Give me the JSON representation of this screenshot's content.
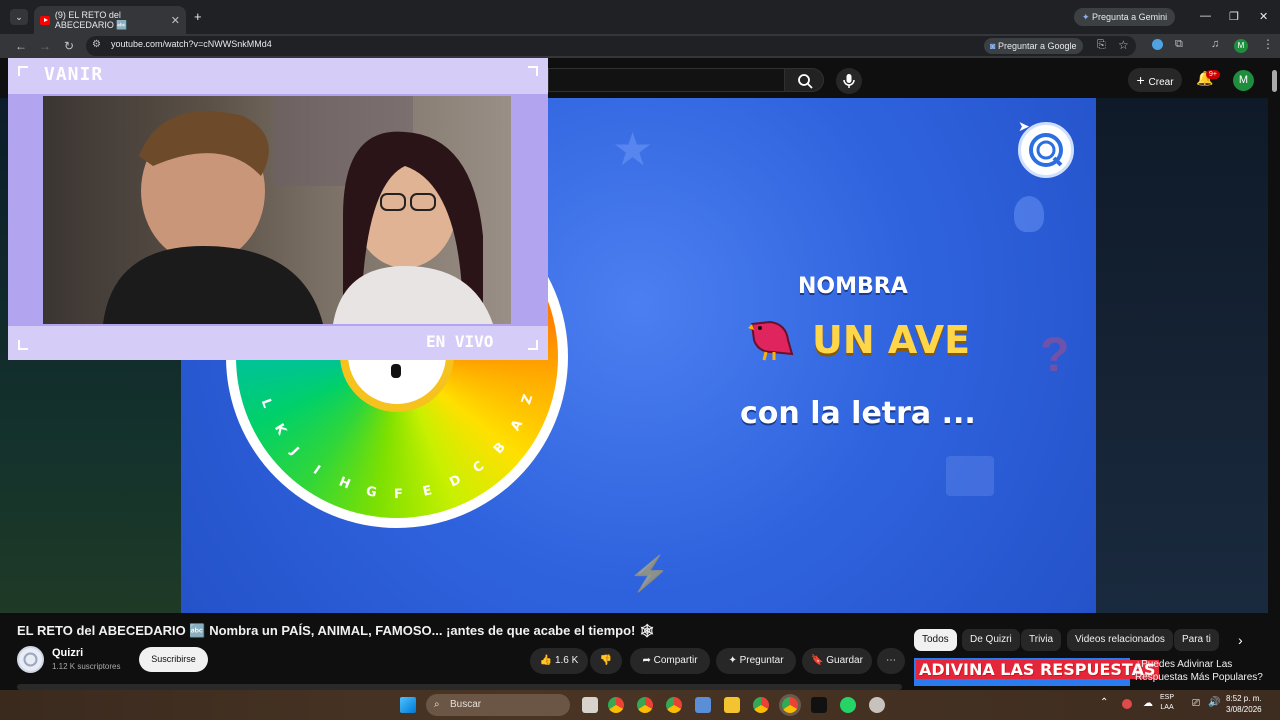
{
  "browser": {
    "tab_title": "(9) EL RETO del ABECEDARIO 🔤",
    "url": "youtube.com/watch?v=cNWWSnkMMd4",
    "ask_google": "Preguntar a Google",
    "ask_gemini": "Pregunta a Gemini",
    "profile_initial": "M"
  },
  "youtube_header": {
    "create_label": "Crear",
    "notification_badge": "9+",
    "avatar_initial": "M"
  },
  "stream_overlay": {
    "name": "VANIR",
    "live_label": "EN VIVO"
  },
  "video": {
    "prompt_top": "NOMBRA",
    "prompt_main": "UN AVE",
    "prompt_bottom": "con la letra ...",
    "wheel_letters": [
      "Z",
      "A",
      "B",
      "C",
      "D",
      "E",
      "F",
      "G",
      "H",
      "I",
      "J",
      "K",
      "L"
    ]
  },
  "video_info": {
    "title": "EL RETO del ABECEDARIO 🔤 Nombra un PAÍS, ANIMAL, FAMOSO... ¡antes de que acabe el tiempo! 🕸",
    "channel_name": "Quizri",
    "subscribers": "1.12 K suscriptores",
    "subscribe_label": "Suscribirse",
    "likes": "1.6 K",
    "share_label": "Compartir",
    "ask_label": "Preguntar",
    "save_label": "Guardar"
  },
  "sidebar": {
    "chips": [
      "Todos",
      "De Quizri",
      "Trivia",
      "Videos relacionados",
      "Para ti"
    ],
    "related_thumb_text": "ADIVINA LAS RESPUESTAS",
    "related_title": "¿Puedes Adivinar Las Respuestas Más Populares?"
  },
  "taskbar": {
    "search_label": "Buscar",
    "lang_top": "ESP",
    "lang_bottom": "LAA",
    "time": "8:52 p. m.",
    "date": "3/08/2026"
  }
}
